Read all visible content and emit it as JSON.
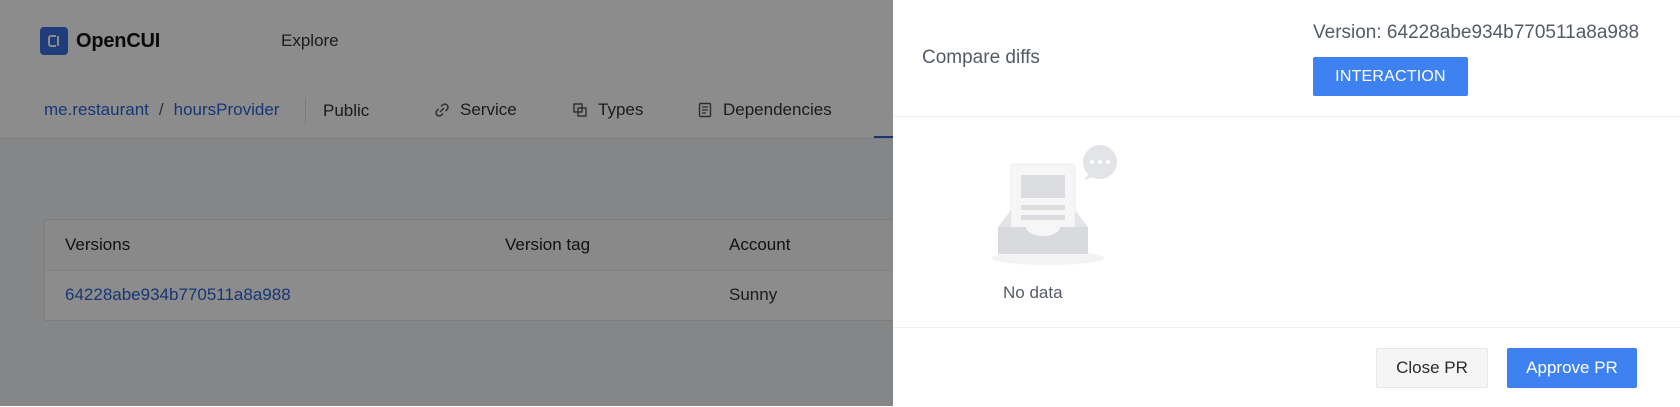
{
  "app": {
    "logo_text": "OpenCUI",
    "nav_explore": "Explore",
    "breadcrumb": {
      "org": "me.restaurant",
      "separator": "/",
      "project": "hoursProvider"
    },
    "visibility": "Public",
    "tabs": [
      {
        "label": "Service",
        "icon": "link-icon"
      },
      {
        "label": "Types",
        "icon": "copy-icon"
      },
      {
        "label": "Dependencies",
        "icon": "document-icon"
      }
    ],
    "table": {
      "headers": [
        "Versions",
        "Version tag",
        "Account"
      ],
      "rows": [
        {
          "version": "64228abe934b770511a8a988",
          "tag": "",
          "account": "Sunny"
        }
      ]
    }
  },
  "drawer": {
    "title": "Compare diffs",
    "version_label": "Version: 64228abe934b770511a8a988",
    "interaction_button": "INTERACTION",
    "empty_text": "No data",
    "close_button": "Close PR",
    "approve_button": "Approve PR"
  },
  "colors": {
    "accent": "#3d82f0",
    "link": "#2b63d6",
    "mask": "rgba(0,0,0,0.45)"
  }
}
